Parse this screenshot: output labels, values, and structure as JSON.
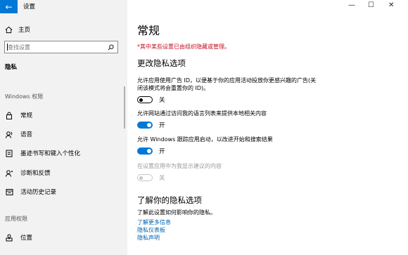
{
  "window": {
    "title": "设置",
    "controls": {
      "minimize": "—",
      "maximize": "☐",
      "close": "✕"
    },
    "accent": "#0078d7"
  },
  "sidebar": {
    "home_label": "主页",
    "search_placeholder": "查找设置",
    "privacy_header": "隐私",
    "windows_perms_label": "Windows 权限",
    "items": [
      {
        "label": "常规",
        "icon": "lock-icon"
      },
      {
        "label": "语音",
        "icon": "speech-icon"
      },
      {
        "label": "墨迹书写和键入个性化",
        "icon": "notepad-icon"
      },
      {
        "label": "诊断和反馈",
        "icon": "diagnostics-icon"
      },
      {
        "label": "活动历史记录",
        "icon": "history-icon"
      }
    ],
    "app_perms_label": "应用权限",
    "app_items": [
      {
        "label": "位置",
        "icon": "location-icon"
      }
    ]
  },
  "main": {
    "title": "常规",
    "warning": "*其中某些设置已由组织隐藏或管理。",
    "warning_color": "#c50f1f",
    "section_title": "更改隐私选项",
    "options": [
      {
        "desc": "允许应用使用广告 ID，以便基于你的应用活动投放你更感兴趣的广告(关闭该模式将会重置你的 ID)。",
        "state": "关",
        "on": false,
        "disabled": false
      },
      {
        "desc": "允许网站通过访问我的语言列表来提供本地相关内容",
        "state": "开",
        "on": true,
        "disabled": false
      },
      {
        "desc": "允许 Windows 跟踪应用启动，以改进开始和搜索结果",
        "state": "开",
        "on": true,
        "disabled": false
      },
      {
        "desc": "在设置应用中为我显示建议的内容",
        "state": "关",
        "on": false,
        "disabled": true
      }
    ],
    "learn_title": "了解你的隐私选项",
    "learn_desc": "了解此设置如何影响你的隐私。",
    "links": [
      "了解更多信息",
      "隐私仪表板",
      "隐私声明"
    ]
  }
}
